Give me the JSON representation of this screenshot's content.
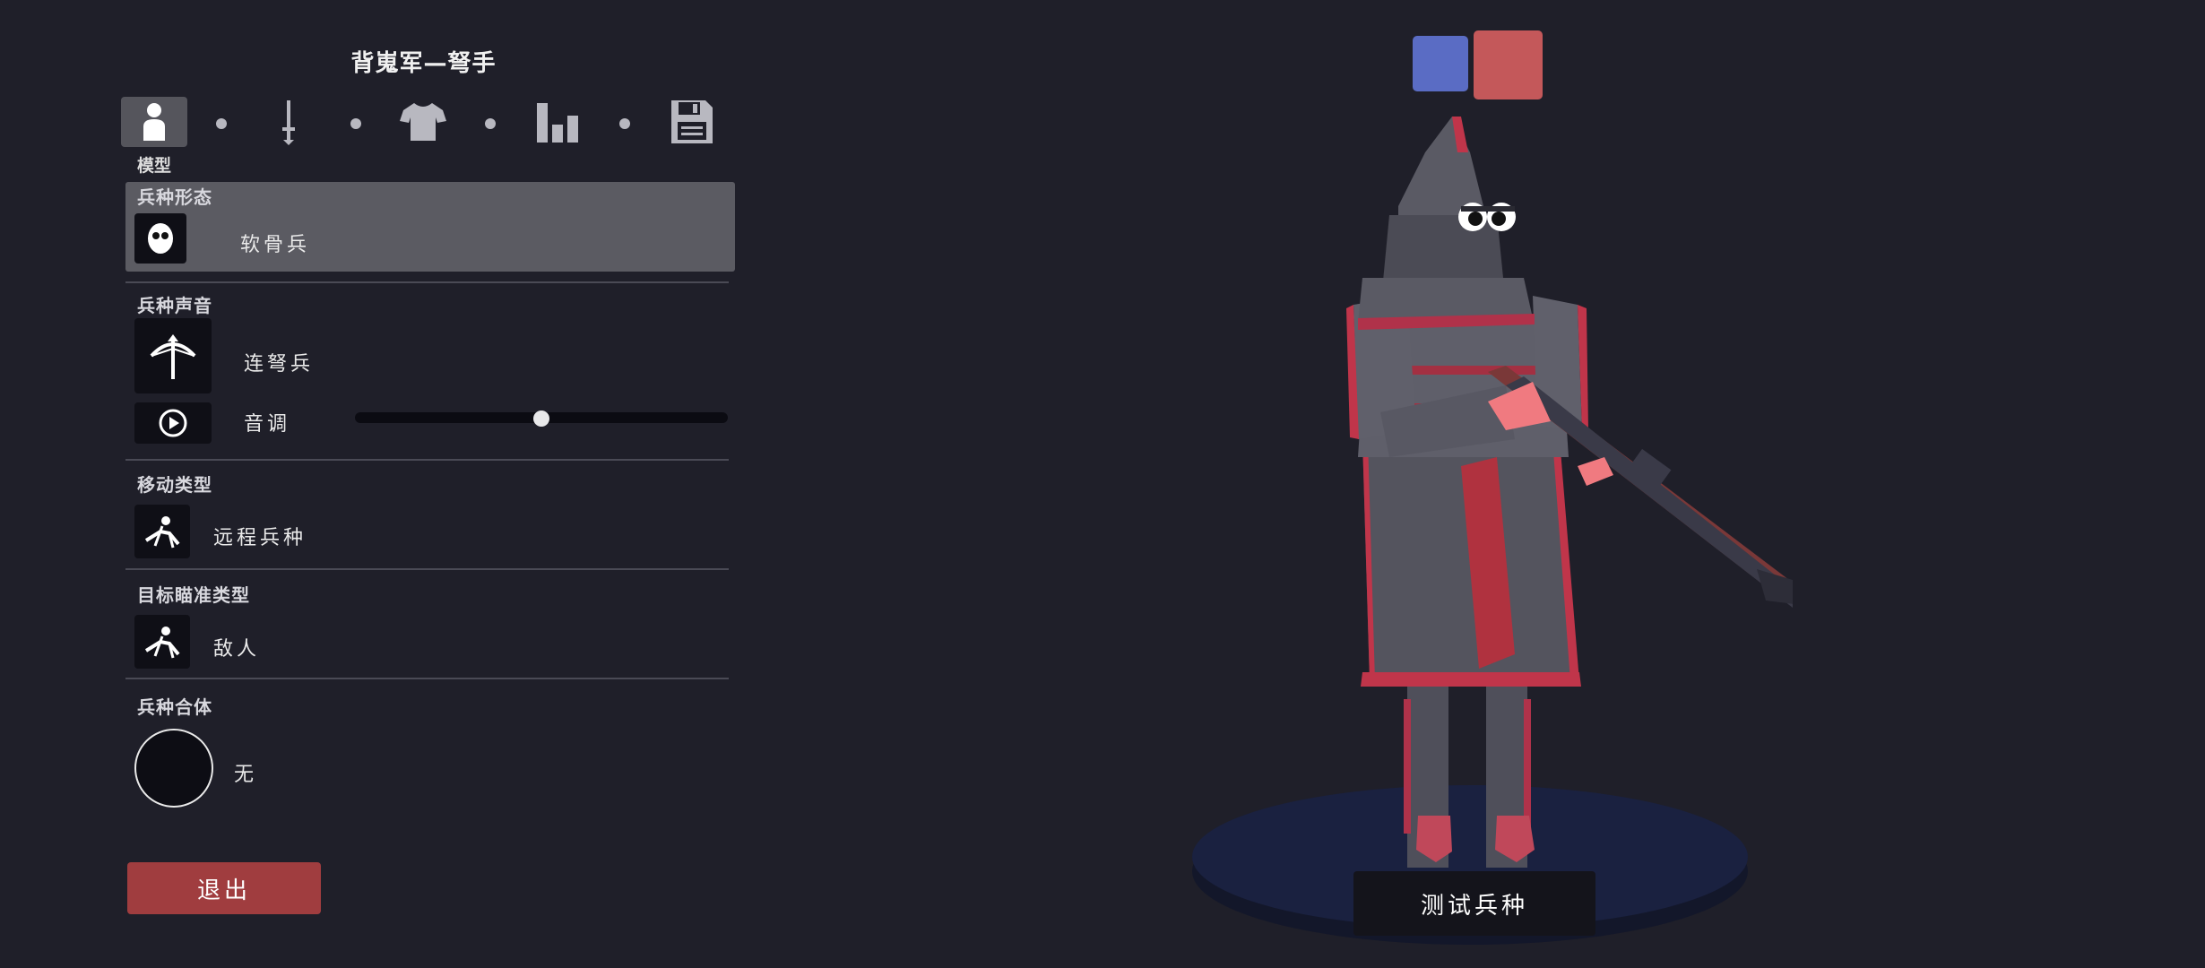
{
  "header": {
    "title": "背嵬军—弩手"
  },
  "tabs": [
    {
      "name": "model",
      "icon": "person-icon",
      "active": true
    },
    {
      "name": "weapons",
      "icon": "sword-icon",
      "active": false
    },
    {
      "name": "clothing",
      "icon": "shirt-icon",
      "active": false
    },
    {
      "name": "stats",
      "icon": "bar-chart-icon",
      "active": false
    },
    {
      "name": "save",
      "icon": "floppy-disk-icon",
      "active": false
    }
  ],
  "active_tab_label": "模型",
  "sections": {
    "form": {
      "title": "兵种形态",
      "value": "软骨兵",
      "icon": "face-icon"
    },
    "voice": {
      "title": "兵种声音",
      "value": "连弩兵",
      "icon": "crossbow-icon",
      "pitch_label": "音调",
      "pitch_value": 0.5,
      "play_icon": "play-icon"
    },
    "movement": {
      "title": "移动类型",
      "value": "远程兵种",
      "icon": "ranged-unit-icon"
    },
    "targeting": {
      "title": "目标瞄准类型",
      "value": "敌人",
      "icon": "target-enemy-icon"
    },
    "fusion": {
      "title": "兵种合体",
      "value": "无",
      "icon": "empty-circle-icon"
    }
  },
  "buttons": {
    "exit": "退出",
    "test": "测试兵种"
  },
  "team_colors": {
    "blue": "#5a6cc4",
    "red": "#c4585a",
    "selected": "red"
  },
  "colors": {
    "background": "#1f1f29",
    "panel_highlight": "#5b5b62",
    "exit_button": "#a03d3f",
    "unit_accent": "#c0354a"
  }
}
